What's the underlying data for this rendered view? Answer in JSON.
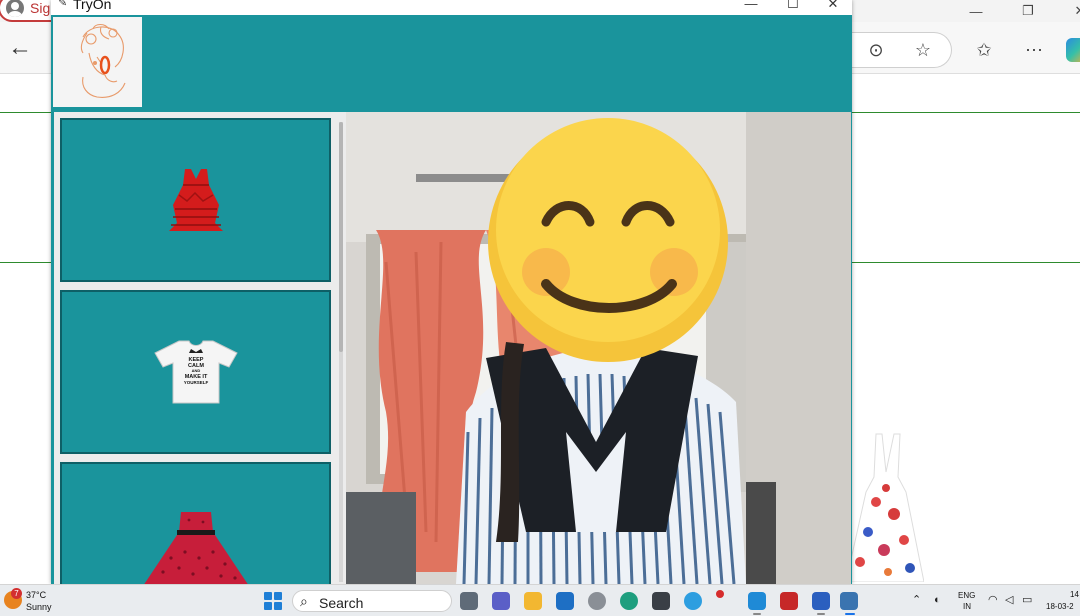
{
  "browser": {
    "signin_label": "Sig",
    "window_controls": {
      "minimize": "—",
      "maximize": "❐",
      "close": "✕"
    },
    "back_glyph": "←",
    "toolbar_icons": [
      "more-tools-icon",
      "favorite-star-icon",
      "favorites-list-icon",
      "more-menu-icon",
      "copilot-icon"
    ],
    "toolbar_glyphs": {
      "more_tools": "⊙",
      "favorite": "☆",
      "favorites": "✩",
      "more": "⋯"
    }
  },
  "tryon": {
    "title": "TryOn",
    "window_controls": {
      "minimize": "—",
      "maximize": "☐",
      "close": "✕"
    },
    "garments": [
      {
        "name": "red-ruffle-top",
        "color": "#d41c1c"
      },
      {
        "name": "keep-calm-tshirt",
        "color": "#f5f5f5",
        "print_lines": [
          "KEEP",
          "CALM",
          "AND",
          "MAKE IT",
          "YOURSELF"
        ]
      },
      {
        "name": "red-polka-dress",
        "color": "#c71e3a"
      }
    ],
    "accent_color": "#1a949c"
  },
  "taskbar": {
    "weather": {
      "badge": "7",
      "temperature": "37°C",
      "condition": "Sunny"
    },
    "search_placeholder": "Search",
    "apps": [
      "task-view-icon",
      "teams-icon",
      "file-explorer-icon",
      "app-icon",
      "photos-icon",
      "edge-icon",
      "store-icon",
      "chrome-icon",
      "vscode-icon",
      "mcafee-icon",
      "vs-icon",
      "word-icon",
      "python-icon"
    ],
    "tray": {
      "lang_top": "ENG",
      "lang_bottom": "IN",
      "time": "14",
      "date": "18-03-2"
    }
  }
}
